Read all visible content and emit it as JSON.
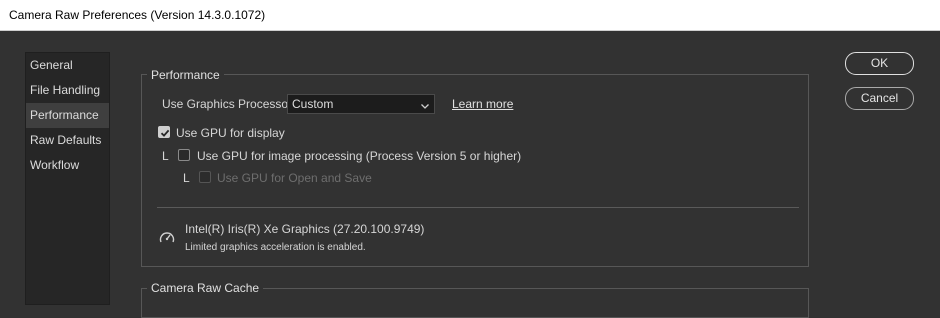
{
  "window": {
    "title": "Camera Raw Preferences  (Version 14.3.0.1072)"
  },
  "sidebar": {
    "items": [
      {
        "label": "General"
      },
      {
        "label": "File Handling"
      },
      {
        "label": "Performance"
      },
      {
        "label": "Raw Defaults"
      },
      {
        "label": "Workflow"
      }
    ],
    "active_index": 2
  },
  "performance": {
    "title": "Performance",
    "gpu_processor_label": "Use Graphics Processor:",
    "gpu_processor_value": "Custom",
    "learn_more": "Learn more",
    "gpu_display": {
      "label": "Use GPU for display",
      "checked": true
    },
    "gpu_image_processing": {
      "prefix": "L",
      "label": "Use GPU for image processing (Process Version 5 or higher)",
      "checked": false
    },
    "gpu_open_save": {
      "prefix": "L",
      "label": "Use GPU for Open and Save",
      "checked": false,
      "disabled": true
    },
    "gpu_name": "Intel(R) Iris(R) Xe Graphics (27.20.100.9749)",
    "gpu_status": "Limited graphics acceleration is enabled."
  },
  "cache": {
    "title": "Camera Raw Cache"
  },
  "buttons": {
    "ok": "OK",
    "cancel": "Cancel"
  },
  "colors": {
    "background": "#323232",
    "sidebar": "#262626",
    "active_item": "#3f3f3f",
    "border": "#575757"
  }
}
